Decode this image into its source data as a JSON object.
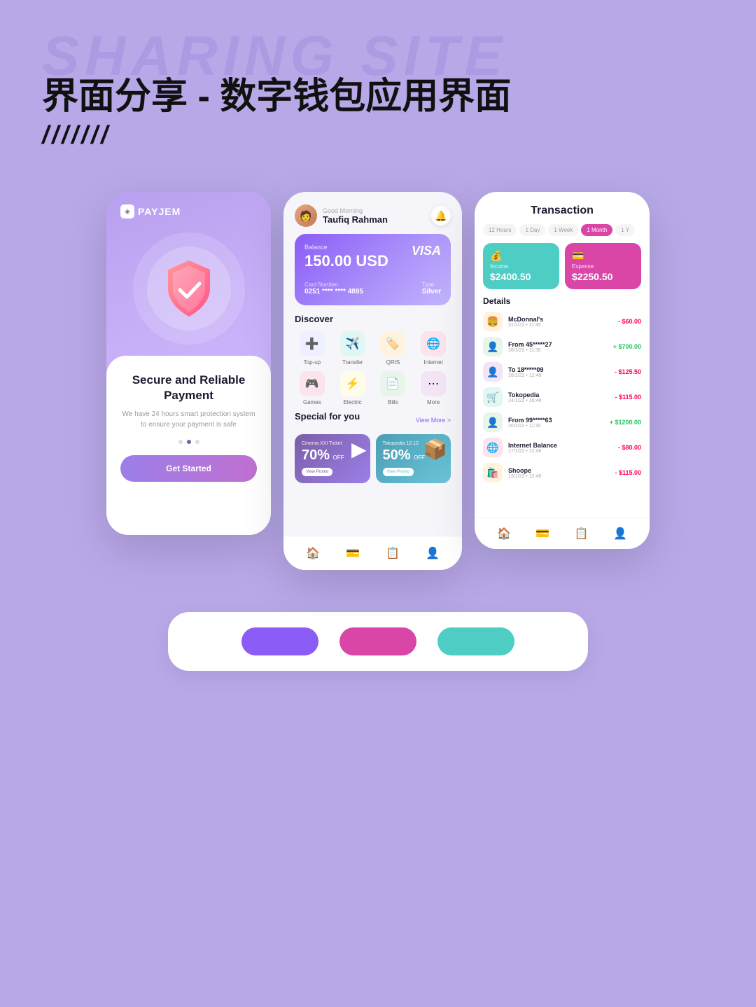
{
  "header": {
    "bg_text": "SHARING SITE",
    "title": "界面分享 - 数字钱包应用界面",
    "slash": "///////"
  },
  "phone1": {
    "brand": "PAYJEM",
    "title": "Secure and Reliable Payment",
    "description": "We have 24 hours smart protection system\nto ensure your payment is safe",
    "cta": "Get Started",
    "dots": [
      false,
      true,
      false
    ]
  },
  "phone2": {
    "greeting": "Good Morning",
    "user_name": "Taufiq Rahman",
    "card": {
      "balance_label": "Balance",
      "balance": "150.00 USD",
      "network": "VISA",
      "card_number_label": "Card Number",
      "card_number": "0251 **** **** 4895",
      "type_label": "Type",
      "type": "Silver"
    },
    "discover": {
      "title": "Discover",
      "items": [
        {
          "label": "Top-up",
          "emoji": "➕",
          "color": "#eef0ff"
        },
        {
          "label": "Transfer",
          "emoji": "✈️",
          "color": "#e0f7f4"
        },
        {
          "label": "QRIS",
          "emoji": "🏷️",
          "color": "#fff3e0"
        },
        {
          "label": "Internet",
          "emoji": "🌐",
          "color": "#fce4ec"
        },
        {
          "label": "Games",
          "emoji": "🎮",
          "color": "#fce4ec"
        },
        {
          "label": "Electric",
          "emoji": "⚡",
          "color": "#fffde7"
        },
        {
          "label": "Bills",
          "emoji": "📄",
          "color": "#e8f5e9"
        },
        {
          "label": "More",
          "emoji": "⋯",
          "color": "#f3e5f5"
        }
      ]
    },
    "special": {
      "title": "Special for you",
      "view_more": "View More >",
      "promos": [
        {
          "name": "Cinema XXI Ticket",
          "discount": "70%",
          "off": "OFF",
          "btn": "View Promo",
          "emoji": "▶️",
          "type": "cinema"
        },
        {
          "name": "Tokopedia 12.12",
          "discount": "50%",
          "off": "OFF",
          "btn": "View Promo",
          "emoji": "📦",
          "type": "tokopedia"
        }
      ]
    }
  },
  "phone3": {
    "title": "Transaction",
    "filters": [
      "12 Hours",
      "1 Day",
      "1 Week",
      "1 Month",
      "1 Y"
    ],
    "active_filter": "1 Month",
    "income": {
      "label": "Income",
      "amount": "$2400.50",
      "icon": "💰"
    },
    "expense": {
      "label": "Expense",
      "amount": "$2250.50",
      "icon": "💳"
    },
    "details_title": "Details",
    "transactions": [
      {
        "name": "McDonnal's",
        "date": "31/1/22 • 11:45",
        "amount": "- $60.00",
        "type": "negative",
        "emoji": "🍔",
        "bg": "#fff3e0"
      },
      {
        "name": "From 45*****27",
        "date": "28/1/22 • 11:30",
        "amount": "+ $700.00",
        "type": "positive",
        "emoji": "👤",
        "bg": "#e8f5e9"
      },
      {
        "name": "To 18*****09",
        "date": "28/1/22 • 12:48",
        "amount": "- $125.50",
        "type": "negative",
        "emoji": "👤",
        "bg": "#f3e5f5"
      },
      {
        "name": "Tokopedia",
        "date": "24/1/22 • 16:48",
        "amount": "- $115.00",
        "type": "negative",
        "emoji": "🛒",
        "bg": "#e0f7f4"
      },
      {
        "name": "From 99*****63",
        "date": "20/1/22 • 11:30",
        "amount": "+ $1200.00",
        "type": "positive",
        "emoji": "👤",
        "bg": "#e8f5e9"
      },
      {
        "name": "Internet Balance",
        "date": "17/1/22 • 12:48",
        "amount": "- $80.00",
        "type": "negative",
        "emoji": "🌐",
        "bg": "#fce4ec"
      },
      {
        "name": "Shoope",
        "date": "13/1/22 • 12:48",
        "amount": "- $115.00",
        "type": "negative",
        "emoji": "🛍️",
        "bg": "#fff3e0"
      }
    ]
  },
  "swatches": {
    "colors": [
      "#8b5cf6",
      "#d946a8",
      "#4ecdc4"
    ]
  }
}
